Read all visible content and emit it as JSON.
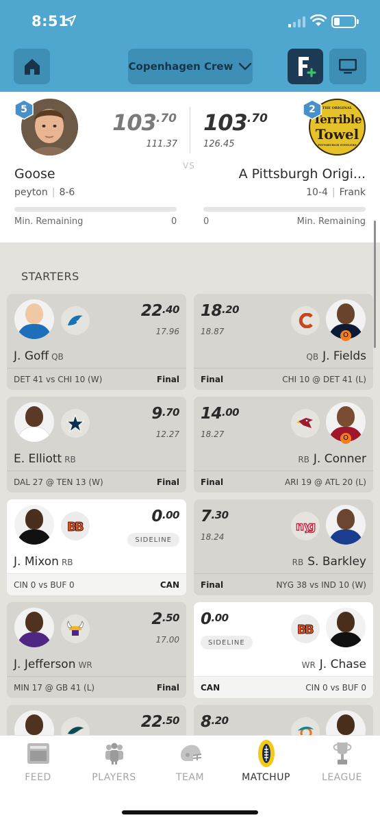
{
  "status_bar": {
    "time": "8:51"
  },
  "header": {
    "league_name": "Copenhagen Crew"
  },
  "matchup": {
    "left": {
      "rank": "5",
      "score_int": "103",
      "score_dec": ".70",
      "projected": "111.37",
      "team_name": "Goose",
      "owner": "peyton",
      "record": "8-6",
      "min_remaining_label": "Min. Remaining",
      "min_remaining_value": "0",
      "progress": 0
    },
    "right": {
      "rank": "2",
      "score_int": "103",
      "score_dec": ".70",
      "projected": "126.45",
      "team_name": "A Pittsburgh Origi...",
      "owner": "Frank",
      "record": "10-4",
      "min_remaining_label": "Min. Remaining",
      "min_remaining_value": "0",
      "progress": 0,
      "avatar_text_top": "THE ORIGINAL",
      "avatar_text_line1": "Terrible",
      "avatar_text_line2": "Towel",
      "avatar_text_bottom": "PITTSBURGH STEELERS"
    },
    "vs_label": "VS"
  },
  "section_title": "STARTERS",
  "starters": [
    {
      "left": {
        "score_int": "22",
        "score_dec": ".40",
        "projected": "17.96",
        "name": "J. Goff",
        "pos": "QB",
        "game": "DET 41 vs CHI 10 (W)",
        "status": "Final",
        "team_icon": "lions-logo-icon",
        "active": false
      },
      "right": {
        "score_int": "18",
        "score_dec": ".20",
        "projected": "18.87",
        "name": "J. Fields",
        "pos": "QB",
        "game": "CHI 10 @ DET 41 (L)",
        "status": "Final",
        "team_icon": "bears-logo-icon",
        "active": false
      }
    },
    {
      "left": {
        "score_int": "9",
        "score_dec": ".70",
        "projected": "12.27",
        "name": "E. Elliott",
        "pos": "RB",
        "game": "DAL 27 @ TEN 13 (W)",
        "status": "Final",
        "team_icon": "cowboys-logo-icon",
        "active": false
      },
      "right": {
        "score_int": "14",
        "score_dec": ".00",
        "projected": "18.27",
        "name": "J. Conner",
        "pos": "RB",
        "game": "ARI 19 @ ATL 20 (L)",
        "status": "Final",
        "team_icon": "cardinals-logo-icon",
        "active": false
      }
    },
    {
      "left": {
        "score_int": "0",
        "score_dec": ".00",
        "badge": "SIDELINE",
        "name": "J. Mixon",
        "pos": "RB",
        "game": "CIN 0 vs BUF 0",
        "status": "CAN",
        "team_icon": "bengals-logo-icon",
        "active": true
      },
      "right": {
        "score_int": "7",
        "score_dec": ".30",
        "projected": "18.24",
        "name": "S. Barkley",
        "pos": "RB",
        "game": "NYG 38 vs IND 10 (W)",
        "status": "Final",
        "team_icon": "giants-logo-icon",
        "active": false
      }
    },
    {
      "left": {
        "score_int": "2",
        "score_dec": ".50",
        "projected": "17.00",
        "name": "J. Jefferson",
        "pos": "WR",
        "game": "MIN 17 @ GB 41 (L)",
        "status": "Final",
        "team_icon": "vikings-logo-icon",
        "active": false
      },
      "right": {
        "score_int": "0",
        "score_dec": ".00",
        "badge": "SIDELINE",
        "name": "J. Chase",
        "pos": "WR",
        "game": "CIN 0 vs BUF 0",
        "status": "CAN",
        "team_icon": "bengals-logo-icon",
        "active": true
      }
    },
    {
      "left": {
        "score_int": "22",
        "score_dec": ".50",
        "team_icon": "eagles-logo-icon"
      },
      "right": {
        "score_int": "8",
        "score_dec": ".20",
        "team_icon": "dolphins-logo-icon"
      }
    }
  ],
  "bottom_nav": [
    {
      "label": "FEED",
      "icon": "feed-icon",
      "selected": false
    },
    {
      "label": "PLAYERS",
      "icon": "players-icon",
      "selected": false
    },
    {
      "label": "TEAM",
      "icon": "helmet-icon",
      "selected": false
    },
    {
      "label": "MATCHUP",
      "icon": "football-icon",
      "selected": true
    },
    {
      "label": "LEAGUE",
      "icon": "trophy-icon",
      "selected": false
    }
  ],
  "colors": {
    "header": "#4fa6cf",
    "header_button": "#3e8fb6",
    "accent_dark": "#1e3b56",
    "accent_green": "#3cc26b",
    "rank_badge": "#4a90c8"
  }
}
